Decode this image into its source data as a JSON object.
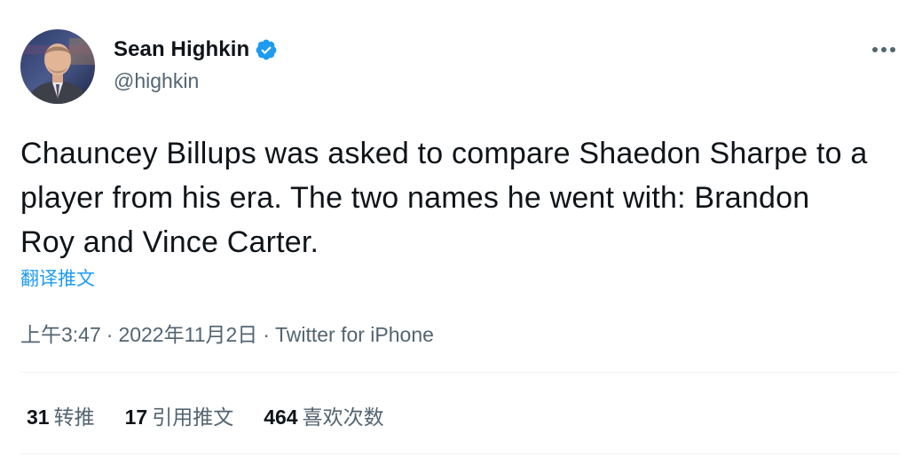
{
  "author": {
    "display_name": "Sean Highkin",
    "handle": "@highkin",
    "verified": true,
    "avatar_icon": "profile-photo",
    "verified_icon": "verified-badge-icon",
    "verified_color": "#1d9bf0"
  },
  "header": {
    "more_icon": "more-horizontal-icon"
  },
  "tweet": {
    "text": "Chauncey Billups was asked to compare Shaedon Sharpe to a player from his era. The two names he went with: Brandon Roy and Vince Carter.",
    "translate_label": "翻译推文"
  },
  "meta": {
    "time": "上午3:47",
    "separator": "·",
    "date": "2022年11月2日",
    "source": "Twitter for iPhone"
  },
  "stats": [
    {
      "count": "31",
      "label": "转推"
    },
    {
      "count": "17",
      "label": "引用推文"
    },
    {
      "count": "464",
      "label": "喜欢次数"
    }
  ],
  "colors": {
    "text_primary": "#0f1419",
    "text_secondary": "#536471",
    "accent": "#1d9bf0",
    "divider": "#eff3f4"
  }
}
